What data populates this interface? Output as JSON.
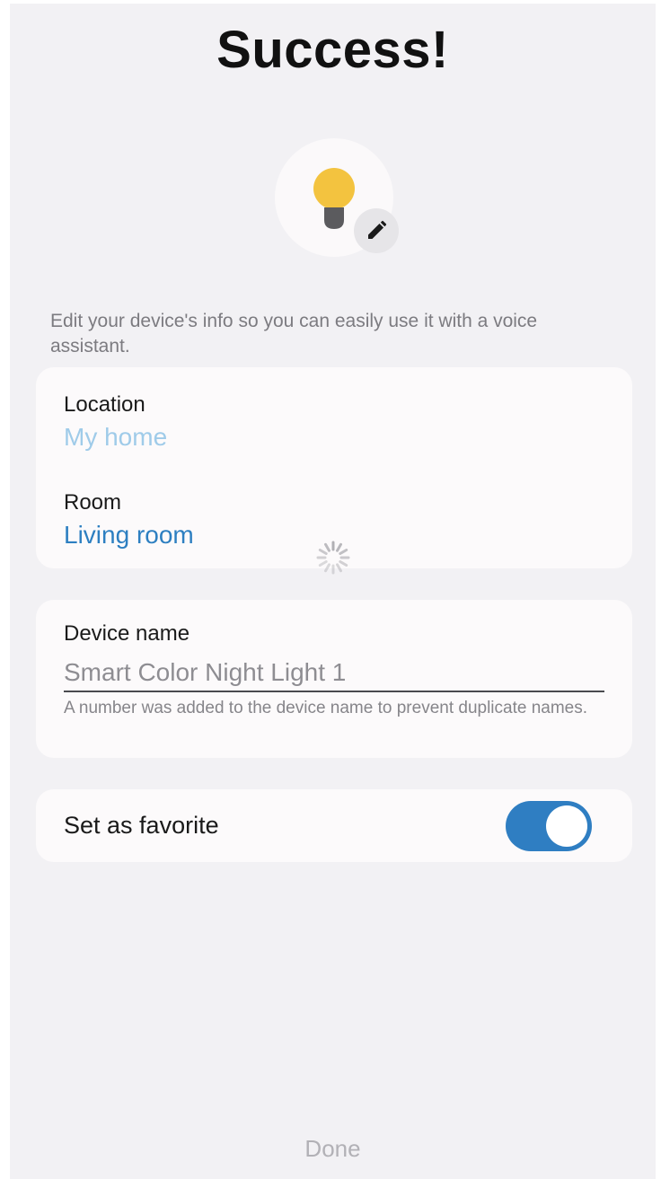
{
  "header": {
    "title": "Success!"
  },
  "device": {
    "icon": "lightbulb-icon",
    "edit_icon": "pencil-icon",
    "bulb_color": "#f3c33f"
  },
  "hint": "Edit your device's info so you can easily use it with a voice assistant.",
  "location_card": {
    "location_label": "Location",
    "location_value": "My home",
    "room_label": "Room",
    "room_value": "Living room"
  },
  "name_card": {
    "label": "Device name",
    "value": "Smart Color Night Light 1",
    "helper": "A number was added to the device name to prevent duplicate names."
  },
  "favorite": {
    "label": "Set as favorite",
    "enabled": true
  },
  "footer": {
    "done_label": "Done"
  },
  "colors": {
    "accent": "#2f7ec2",
    "background": "#f2f1f4",
    "card": "#fcfafb"
  }
}
